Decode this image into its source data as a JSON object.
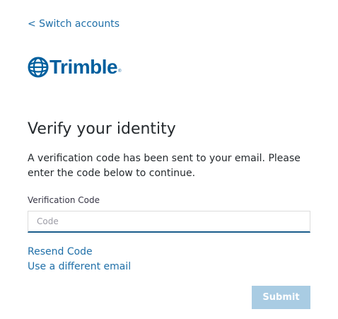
{
  "nav": {
    "switch_accounts_label": "< Switch accounts"
  },
  "brand": {
    "logo_text": "Trimble",
    "logo_mark": "®",
    "logo_icon": "globe-icon",
    "color": "#005f9e"
  },
  "verify": {
    "title": "Verify your identity",
    "message": "A verification code has been sent to your email. Please enter the code below to continue.",
    "field_label": "Verification Code",
    "code_placeholder": "Code",
    "code_value": "",
    "resend_label": "Resend Code",
    "different_email_label": "Use a different email",
    "submit_label": "Submit"
  },
  "colors": {
    "link": "#1f6fa8",
    "submit_disabled": "#a9cce3",
    "input_focus_border": "#1a5c8b",
    "text": "#252a2e"
  }
}
